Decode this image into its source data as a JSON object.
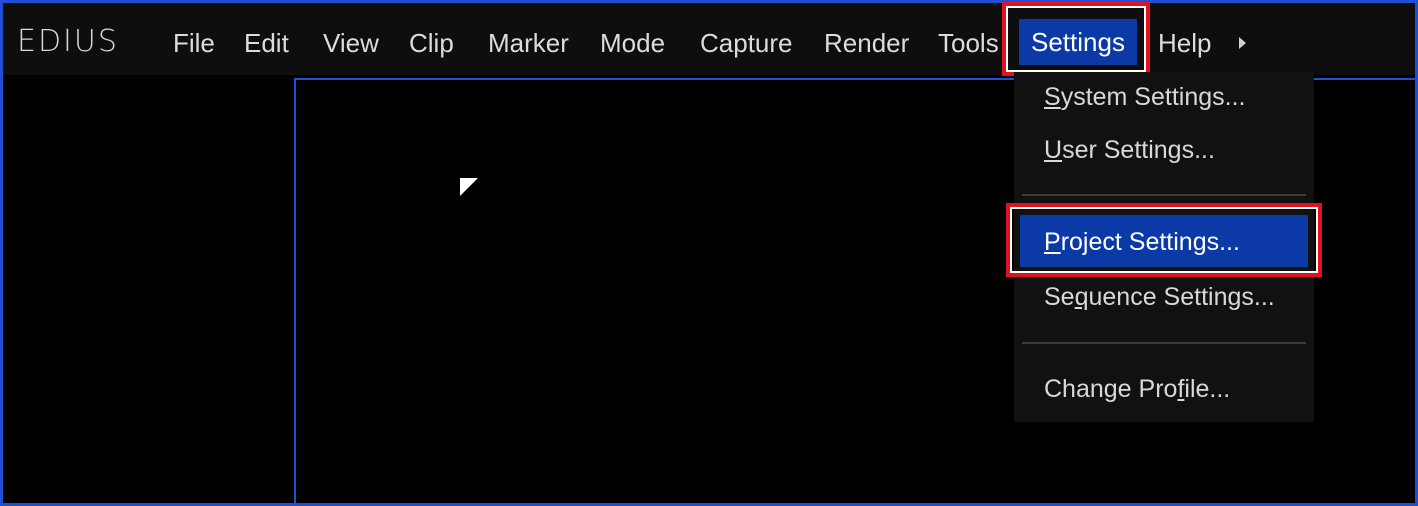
{
  "app": {
    "logo_text": "EDIUS"
  },
  "menubar": {
    "items": [
      {
        "label": "File"
      },
      {
        "label": "Edit"
      },
      {
        "label": "View"
      },
      {
        "label": "Clip"
      },
      {
        "label": "Marker"
      },
      {
        "label": "Mode"
      },
      {
        "label": "Capture"
      },
      {
        "label": "Render"
      },
      {
        "label": "Tools"
      },
      {
        "label": "Settings",
        "active": true
      },
      {
        "label": "Help"
      }
    ],
    "overflow_icon": "chevron-right-icon"
  },
  "settings_menu": {
    "items": [
      {
        "pre": "",
        "mnemonic": "S",
        "post": "ystem Settings..."
      },
      {
        "pre": "",
        "mnemonic": "U",
        "post": "ser Settings..."
      },
      {
        "pre": "",
        "mnemonic": "P",
        "post": "roject Settings...",
        "highlighted": true
      },
      {
        "pre": "Se",
        "mnemonic": "q",
        "post": "uence Settings..."
      },
      {
        "pre": "Change Pro",
        "mnemonic": "f",
        "post": "ile..."
      }
    ]
  },
  "colors": {
    "highlight_blue": "#0b3aa6",
    "annotation_red": "#e0121d",
    "panel_border": "#1f4fd6"
  }
}
